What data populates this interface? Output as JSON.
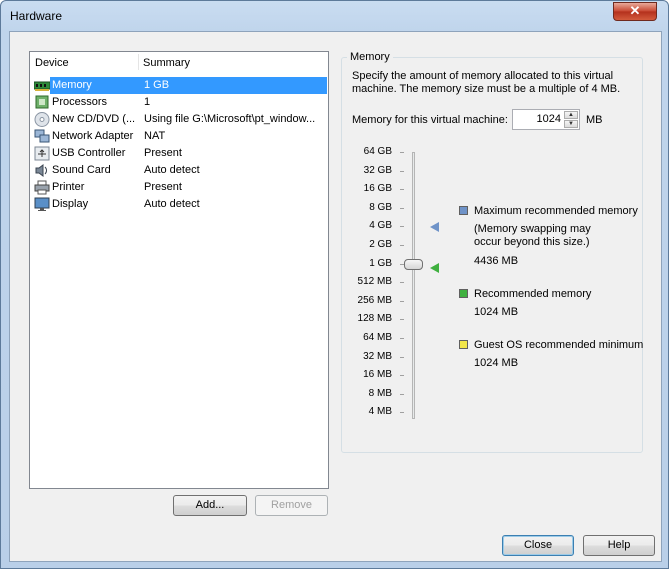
{
  "window": {
    "title": "Hardware",
    "close_glyph": "✕"
  },
  "devices": {
    "headers": {
      "device": "Device",
      "summary": "Summary"
    },
    "rows": [
      {
        "name": "Memory",
        "summary": "1 GB",
        "icon": "memory-icon",
        "selected": true
      },
      {
        "name": "Processors",
        "summary": "1",
        "icon": "processor-icon"
      },
      {
        "name": "New CD/DVD (...",
        "summary": "Using file G:\\Microsoft\\pt_window...",
        "icon": "cd-dvd-icon"
      },
      {
        "name": "Network Adapter",
        "summary": "NAT",
        "icon": "network-adapter-icon"
      },
      {
        "name": "USB Controller",
        "summary": "Present",
        "icon": "usb-icon"
      },
      {
        "name": "Sound Card",
        "summary": "Auto detect",
        "icon": "speaker-icon"
      },
      {
        "name": "Printer",
        "summary": "Present",
        "icon": "printer-icon"
      },
      {
        "name": "Display",
        "summary": "Auto detect",
        "icon": "monitor-icon"
      }
    ],
    "add_label": "Add...",
    "remove_label": "Remove"
  },
  "memory": {
    "group_title": "Memory",
    "description": "Specify the amount of memory allocated to this virtual machine. The memory size must be a multiple of 4 MB.",
    "field_label": "Memory for this virtual machine:",
    "value": "1024",
    "unit": "MB",
    "scale": [
      "64 GB",
      "32 GB",
      "16 GB",
      "8 GB",
      "4 GB",
      "2 GB",
      "1 GB",
      "512 MB",
      "256 MB",
      "128 MB",
      "64 MB",
      "32 MB",
      "16 MB",
      "8 MB",
      "4 MB"
    ],
    "selected_scale": "1 GB",
    "legend": {
      "max_title": "Maximum recommended memory",
      "max_note": "(Memory swapping may occur beyond this size.)",
      "max_value": "4436 MB",
      "max_color": "#6f93c8",
      "rec_title": "Recommended memory",
      "rec_value": "1024 MB",
      "rec_color": "#3fb03f",
      "min_title": "Guest OS recommended minimum",
      "min_value": "1024 MB",
      "min_color": "#f2e64a"
    }
  },
  "footer": {
    "close_label": "Close",
    "help_label": "Help"
  }
}
